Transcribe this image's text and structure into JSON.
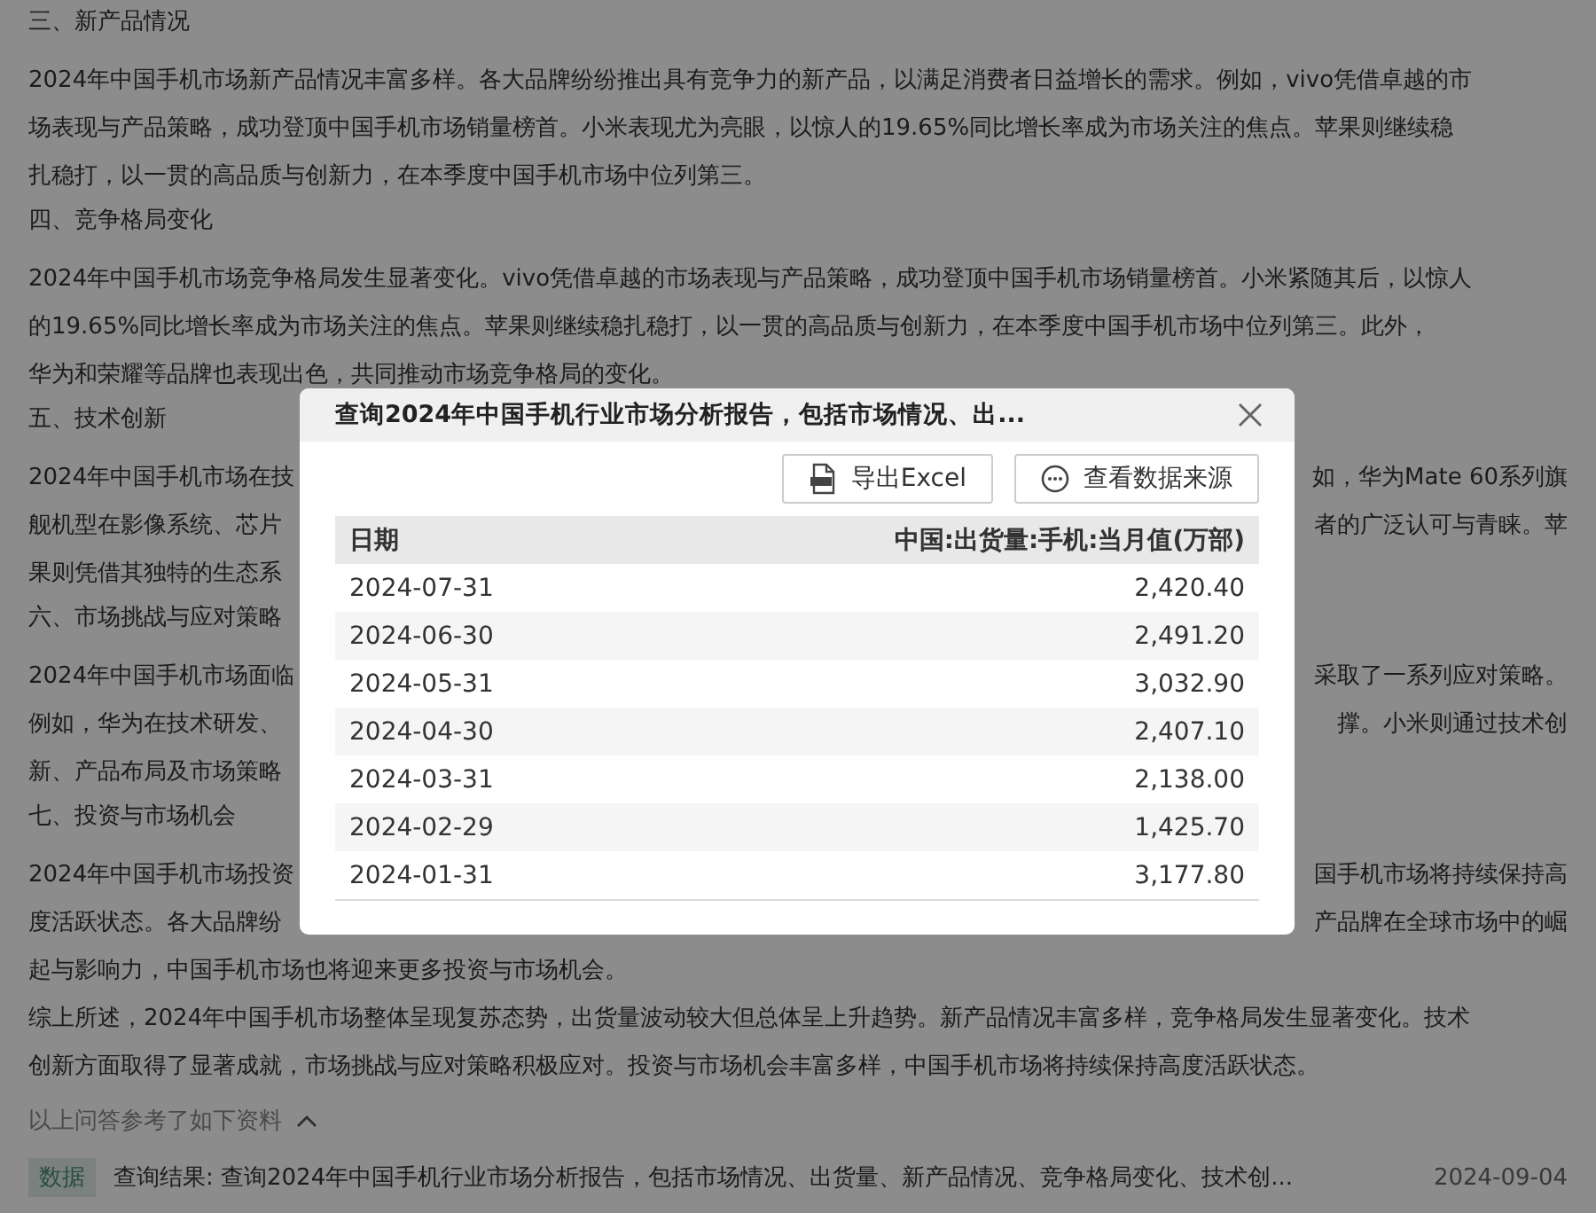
{
  "content": [
    {
      "kind": "heading",
      "text": "三、新产品情况"
    },
    {
      "kind": "paragraph",
      "lines": [
        {
          "left": "2024年中国手机市场新产品情况丰富多样。各大品牌纷纷推出具有竞争力的新产品，以满足消费者日益增长的需求。例如，vivo凭借卓越的市"
        },
        {
          "left": "场表现与产品策略，成功登顶中国手机市场销量榜首。小米表现尤为亮眼，以惊人的19.65%同比增长率成为市场关注的焦点。苹果则继续稳"
        },
        {
          "left": "扎稳打，以一贯的高品质与创新力，在本季度中国手机市场中位列第三。"
        }
      ]
    },
    {
      "kind": "heading",
      "text": "四、竞争格局变化"
    },
    {
      "kind": "paragraph",
      "lines": [
        {
          "left": "2024年中国手机市场竞争格局发生显著变化。vivo凭借卓越的市场表现与产品策略，成功登顶中国手机市场销量榜首。小米紧随其后，以惊人"
        },
        {
          "left": "的19.65%同比增长率成为市场关注的焦点。苹果则继续稳扎稳打，以一贯的高品质与创新力，在本季度中国手机市场中位列第三。此外，"
        },
        {
          "left": "华为和荣耀等品牌也表现出色，共同推动市场竞争格局的变化。"
        }
      ]
    },
    {
      "kind": "heading",
      "text": "五、技术创新"
    },
    {
      "kind": "paragraph",
      "lines": [
        {
          "left": "2024年中国手机市场在技",
          "right": "如，华为Mate 60系列旗"
        },
        {
          "left": "舰机型在影像系统、芯片",
          "right": "者的广泛认可与青睐。苹"
        },
        {
          "left": "果则凭借其独特的生态系"
        }
      ]
    },
    {
      "kind": "heading",
      "text": "六、市场挑战与应对策略"
    },
    {
      "kind": "paragraph",
      "lines": [
        {
          "left": "2024年中国手机市场面临",
          "right": "采取了一系列应对策略。"
        },
        {
          "left": "例如，华为在技术研发、",
          "right": "撑。小米则通过技术创"
        },
        {
          "left": "新、产品布局及市场策略"
        }
      ]
    },
    {
      "kind": "heading",
      "text": "七、投资与市场机会"
    },
    {
      "kind": "paragraph",
      "lines": [
        {
          "left": "2024年中国手机市场投资",
          "right": "国手机市场将持续保持高"
        },
        {
          "left": "度活跃状态。各大品牌纷",
          "right": "产品牌在全球市场中的崛"
        },
        {
          "left": "起与影响力，中国手机市场也将迎来更多投资与市场机会。"
        }
      ]
    },
    {
      "kind": "paragraph",
      "lines": [
        {
          "left": "综上所述，2024年中国手机市场整体呈现复苏态势，出货量波动较大但总体呈上升趋势。新产品情况丰富多样，竞争格局发生显著变化。技术"
        },
        {
          "left": "创新方面取得了显著成就，市场挑战与应对策略积极应对。投资与市场机会丰富多样，中国手机市场将持续保持高度活跃状态。"
        }
      ]
    }
  ],
  "references": {
    "label": "以上问答参考了如下资料",
    "expanded": true,
    "items": [
      {
        "tag": "数据",
        "text": "查询结果: 查询2024年中国手机行业市场分析报告，包括市场情况、出货量、新产品情况、竞争格局变化、技术创...",
        "date": "2024-09-04"
      }
    ]
  },
  "dialog": {
    "title": "查询2024年中国手机行业市场分析报告，包括市场情况、出...",
    "buttons": [
      {
        "kind": "excel",
        "label": "导出Excel"
      },
      {
        "kind": "source",
        "label": "查看数据来源"
      }
    ],
    "table": {
      "columns": [
        "日期",
        "中国:出货量:手机:当月值(万部)"
      ],
      "rows": [
        [
          "2024-07-31",
          "2,420.40"
        ],
        [
          "2024-06-30",
          "2,491.20"
        ],
        [
          "2024-05-31",
          "3,032.90"
        ],
        [
          "2024-04-30",
          "2,407.10"
        ],
        [
          "2024-03-31",
          "2,138.00"
        ],
        [
          "2024-02-29",
          "1,425.70"
        ],
        [
          "2024-01-31",
          "3,177.80"
        ]
      ]
    }
  }
}
